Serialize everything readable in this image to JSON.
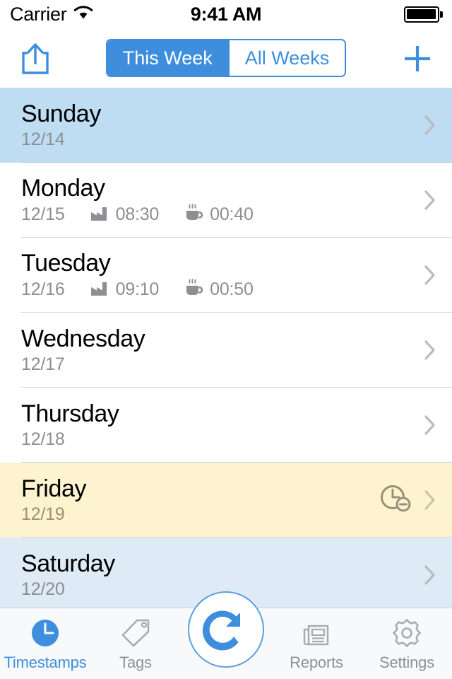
{
  "status_bar": {
    "carrier": "Carrier",
    "wifi_icon": "wifi-icon",
    "time": "9:41 AM",
    "battery_icon": "battery-full-icon"
  },
  "nav_bar": {
    "share_icon": "share-icon",
    "add_icon": "plus-icon",
    "segments": [
      {
        "label": "This Week",
        "selected": true
      },
      {
        "label": "All Weeks",
        "selected": false
      }
    ]
  },
  "colors": {
    "accent": "#3e8edd",
    "today_row": "#bedcf2",
    "weekend_row": "#dfeaf7",
    "warning_row": "#fdf3cf",
    "secondary_text": "#8e8e93",
    "tab_inactive": "#8e9194"
  },
  "list": {
    "rows": [
      {
        "day": "Sunday",
        "date": "12/14",
        "work_icon": "",
        "work_time": "",
        "break_icon": "",
        "break_time": "",
        "state": "today",
        "alert_icon": ""
      },
      {
        "day": "Monday",
        "date": "12/15",
        "work_icon": "factory-icon",
        "work_time": "08:30",
        "break_icon": "coffee-cup-icon",
        "break_time": "00:40",
        "state": "normal",
        "alert_icon": ""
      },
      {
        "day": "Tuesday",
        "date": "12/16",
        "work_icon": "factory-icon",
        "work_time": "09:10",
        "break_icon": "coffee-cup-icon",
        "break_time": "00:50",
        "state": "normal",
        "alert_icon": ""
      },
      {
        "day": "Wednesday",
        "date": "12/17",
        "work_icon": "",
        "work_time": "",
        "break_icon": "",
        "break_time": "",
        "state": "normal",
        "alert_icon": ""
      },
      {
        "day": "Thursday",
        "date": "12/18",
        "work_icon": "",
        "work_time": "",
        "break_icon": "",
        "break_time": "",
        "state": "normal",
        "alert_icon": ""
      },
      {
        "day": "Friday",
        "date": "12/19",
        "work_icon": "",
        "work_time": "",
        "break_icon": "",
        "break_time": "",
        "state": "warning",
        "alert_icon": "clock-minus-icon"
      },
      {
        "day": "Saturday",
        "date": "12/20",
        "work_icon": "",
        "work_time": "",
        "break_icon": "",
        "break_time": "",
        "state": "weekend",
        "alert_icon": ""
      }
    ],
    "disclosure_icon": "chevron-right-icon"
  },
  "tab_bar": {
    "tabs": [
      {
        "label": "Timestamps",
        "icon": "clock-filled-icon",
        "active": true
      },
      {
        "label": "Tags",
        "icon": "tag-icon",
        "active": false
      },
      {
        "label": "Reports",
        "icon": "newspaper-icon",
        "active": false
      },
      {
        "label": "Settings",
        "icon": "gear-icon",
        "active": false
      }
    ],
    "action_button_icon": "redo-arrow-icon"
  }
}
